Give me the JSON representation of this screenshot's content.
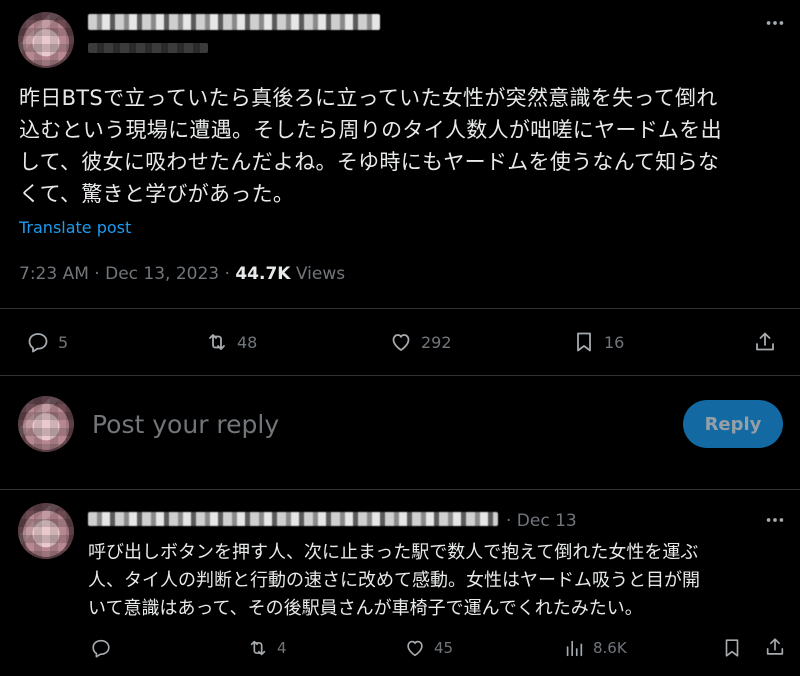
{
  "post": {
    "text": "昨日BTSで立っていたら真後ろに立っていた女性が突然意識を失って倒れ\n込むという現場に遭遇。そしたら周りのタイ人数人が咄嗟にヤードムを出\nして、彼女に吸わせたんだよね。そゆ時にもヤードムを使うなんて知らな\nくて、驚きと学びがあった。",
    "translate_label": "Translate post",
    "time": "7:23 AM",
    "date": "Dec 13, 2023",
    "views_count": "44.7K",
    "views_label": "Views",
    "actions": {
      "replies": "5",
      "reposts": "48",
      "likes": "292",
      "bookmarks": "16"
    }
  },
  "composer": {
    "placeholder": "Post your reply",
    "reply_button": "Reply"
  },
  "reply": {
    "date": "· Dec 13",
    "text": "呼び出しボタンを押す人、次に止まった駅で数人で抱えて倒れた女性を運ぶ\n人、タイ人の判断と行動の速さに改めて感動。女性はヤードム吸うと目が開\nいて意識はあって、その後駅員さんが車椅子で運んでくれたみたい。",
    "actions": {
      "reposts": "4",
      "likes": "45",
      "views": "8.6K"
    }
  },
  "colors": {
    "background": "#000000",
    "text": "#e7e9ea",
    "muted": "#71767b",
    "accent": "#1d9bf0",
    "divider": "#2f3336"
  },
  "icons": [
    "more-icon",
    "reply-icon",
    "repost-icon",
    "like-icon",
    "bookmark-icon",
    "share-icon",
    "views-icon"
  ]
}
